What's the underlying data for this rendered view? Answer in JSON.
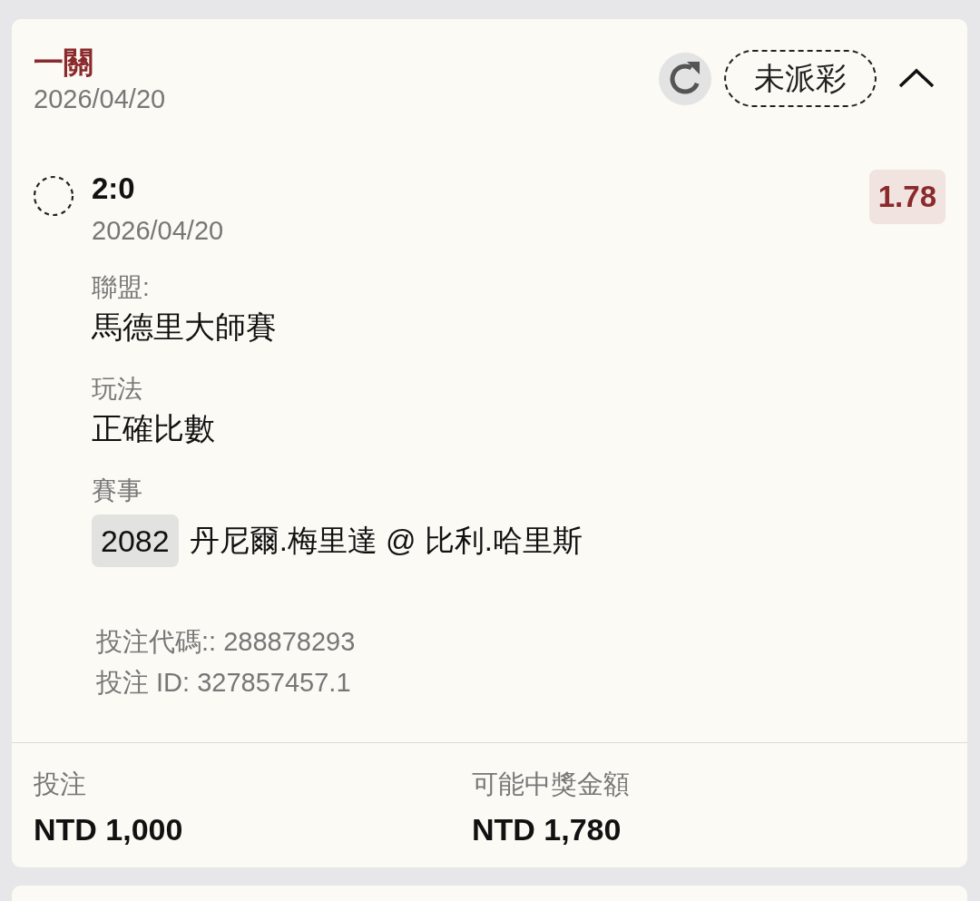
{
  "bet": {
    "title": "一關",
    "date": "2026/04/20",
    "status": {
      "label": "未派彩"
    },
    "expanded": true,
    "selection": {
      "result": "2:0",
      "date": "2026/04/20",
      "odds": "1.78",
      "fields": [
        {
          "label": "聯盟:",
          "value": "馬德里大師賽"
        },
        {
          "label": "玩法",
          "value": "正確比數"
        },
        {
          "label": "賽事",
          "event_no": "2082",
          "value": "丹尼爾.梅里達 @ 比利.哈里斯"
        }
      ]
    },
    "codes": [
      "投注代碼:: 288878293",
      "投注 ID: 327857457.1"
    ],
    "summary": [
      {
        "label": "投注",
        "value": "NTD 1,000"
      },
      {
        "label": "可能中獎金額",
        "value": "NTD 1,780"
      }
    ]
  }
}
